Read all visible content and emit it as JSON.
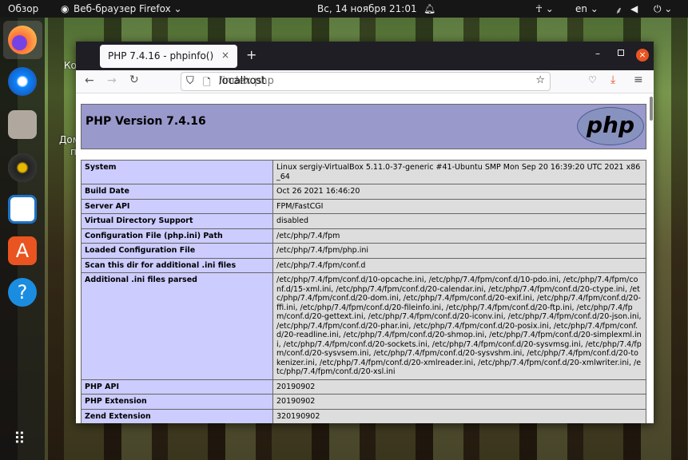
{
  "topbar": {
    "overview": "Обзор",
    "app": "Веб-браузер Firefox ⌄",
    "clock": "Вс, 14 ноября  21:01",
    "lang": "en ⌄"
  },
  "desktop": {
    "icon1": "Ко",
    "icon2a": "Дом",
    "icon2b": "п"
  },
  "browser": {
    "tab_title": "PHP 7.4.16 - phpinfo()",
    "url_host": "localhost",
    "url_path": "/index.php"
  },
  "php": {
    "title": "PHP Version 7.4.16",
    "logo": "php",
    "rows": [
      {
        "k": "System",
        "v": "Linux sergiy-VirtualBox 5.11.0-37-generic #41-Ubuntu SMP Mon Sep 20 16:39:20 UTC 2021 x86_64"
      },
      {
        "k": "Build Date",
        "v": "Oct 26 2021 16:46:20"
      },
      {
        "k": "Server API",
        "v": "FPM/FastCGI"
      },
      {
        "k": "Virtual Directory Support",
        "v": "disabled"
      },
      {
        "k": "Configuration File (php.ini) Path",
        "v": "/etc/php/7.4/fpm"
      },
      {
        "k": "Loaded Configuration File",
        "v": "/etc/php/7.4/fpm/php.ini"
      },
      {
        "k": "Scan this dir for additional .ini files",
        "v": "/etc/php/7.4/fpm/conf.d"
      },
      {
        "k": "Additional .ini files parsed",
        "v": "/etc/php/7.4/fpm/conf.d/10-opcache.ini, /etc/php/7.4/fpm/conf.d/10-pdo.ini, /etc/php/7.4/fpm/conf.d/15-xml.ini, /etc/php/7.4/fpm/conf.d/20-calendar.ini, /etc/php/7.4/fpm/conf.d/20-ctype.ini, /etc/php/7.4/fpm/conf.d/20-dom.ini, /etc/php/7.4/fpm/conf.d/20-exif.ini, /etc/php/7.4/fpm/conf.d/20-ffi.ini, /etc/php/7.4/fpm/conf.d/20-fileinfo.ini, /etc/php/7.4/fpm/conf.d/20-ftp.ini, /etc/php/7.4/fpm/conf.d/20-gettext.ini, /etc/php/7.4/fpm/conf.d/20-iconv.ini, /etc/php/7.4/fpm/conf.d/20-json.ini, /etc/php/7.4/fpm/conf.d/20-phar.ini, /etc/php/7.4/fpm/conf.d/20-posix.ini, /etc/php/7.4/fpm/conf.d/20-readline.ini, /etc/php/7.4/fpm/conf.d/20-shmop.ini, /etc/php/7.4/fpm/conf.d/20-simplexml.ini, /etc/php/7.4/fpm/conf.d/20-sockets.ini, /etc/php/7.4/fpm/conf.d/20-sysvmsg.ini, /etc/php/7.4/fpm/conf.d/20-sysvsem.ini, /etc/php/7.4/fpm/conf.d/20-sysvshm.ini, /etc/php/7.4/fpm/conf.d/20-tokenizer.ini, /etc/php/7.4/fpm/conf.d/20-xmlreader.ini, /etc/php/7.4/fpm/conf.d/20-xmlwriter.ini, /etc/php/7.4/fpm/conf.d/20-xsl.ini"
      },
      {
        "k": "PHP API",
        "v": "20190902"
      },
      {
        "k": "PHP Extension",
        "v": "20190902"
      },
      {
        "k": "Zend Extension",
        "v": "320190902"
      }
    ]
  }
}
